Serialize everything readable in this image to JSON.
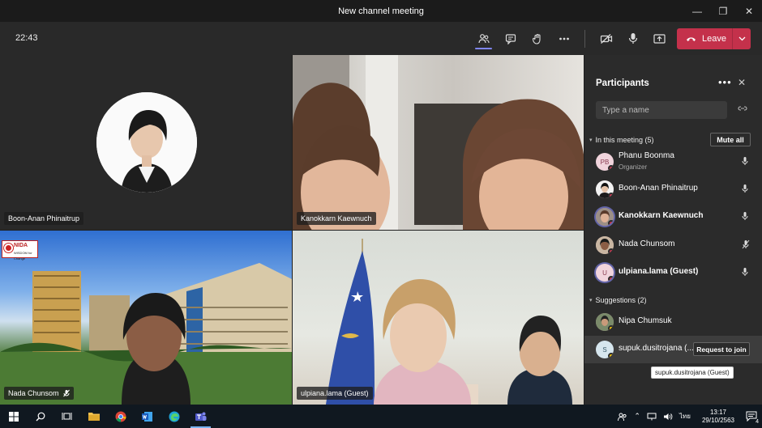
{
  "window": {
    "title": "New channel meeting"
  },
  "toolbar": {
    "time": "22:43",
    "leave_label": "Leave"
  },
  "tiles": [
    {
      "name": "Boon-Anan Phinaitrup"
    },
    {
      "name": "Kanokkarn Kaewnuch"
    },
    {
      "name": "Nada Chunsom",
      "muted": true
    },
    {
      "name": "ulpiana.lama (Guest)"
    }
  ],
  "logo": {
    "text": "NIDA",
    "tagline": "WISDOM for Change"
  },
  "panel": {
    "title": "Participants",
    "search_placeholder": "Type a name",
    "in_meeting_label": "In this meeting (5)",
    "mute_all_label": "Mute all",
    "participants": [
      {
        "initials": "PB",
        "name": "Phanu Boonma",
        "role": "Organizer",
        "status": "red"
      },
      {
        "initials": "",
        "name": "Boon-Anan Phinaitrup",
        "status": "red"
      },
      {
        "initials": "",
        "name": "Kanokkarn Kaewnuch",
        "status": "red",
        "bold": true
      },
      {
        "initials": "",
        "name": "Nada Chunsom",
        "status": "red",
        "muted": true
      },
      {
        "initials": "U",
        "name": "ulpiana.lama (Guest)",
        "status": "red",
        "bold": true
      }
    ],
    "suggestions_label": "Suggestions (2)",
    "suggestions": [
      {
        "initials": "",
        "name": "Nipa Chumsuk",
        "status": "yellow"
      },
      {
        "initials": "S",
        "name": "supuk.dusitrojana (...",
        "status": "yellow",
        "action": "Request to join"
      }
    ],
    "tooltip": "supuk.dusitrojana (Guest)"
  },
  "taskbar": {
    "time": "13:17",
    "date": "29/10/2563",
    "lang": "ไทย",
    "notif_count": "4"
  },
  "colors": {
    "accent": "#7f85f5",
    "leave": "#c4314b",
    "status_red": "#c4314b",
    "status_yellow": "#f8c400"
  }
}
